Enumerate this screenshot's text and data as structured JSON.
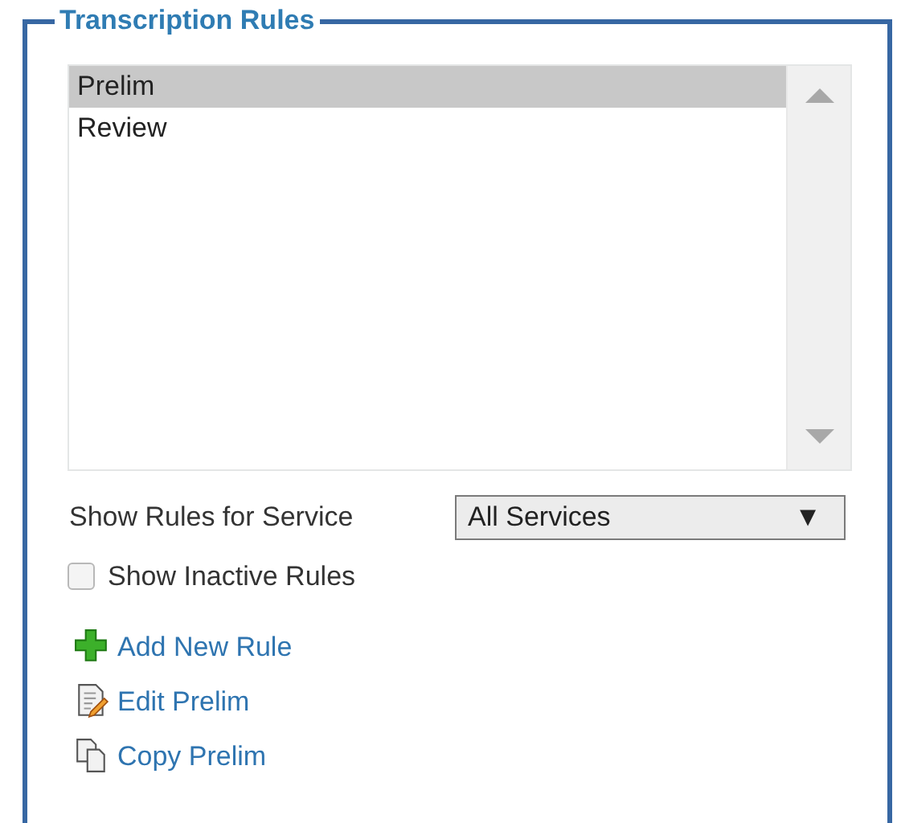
{
  "panel": {
    "title": "Transcription Rules"
  },
  "rules": [
    {
      "label": "Prelim",
      "selected": true
    },
    {
      "label": "Review",
      "selected": false
    }
  ],
  "service_filter": {
    "label": "Show Rules for Service",
    "value": "All Services",
    "arrow": "▼"
  },
  "show_inactive": {
    "label": "Show Inactive Rules",
    "checked": false
  },
  "actions": [
    {
      "kind": "add",
      "label": "Add New Rule"
    },
    {
      "kind": "edit",
      "label": "Edit Prelim"
    },
    {
      "kind": "copy",
      "label": "Copy Prelim"
    }
  ]
}
